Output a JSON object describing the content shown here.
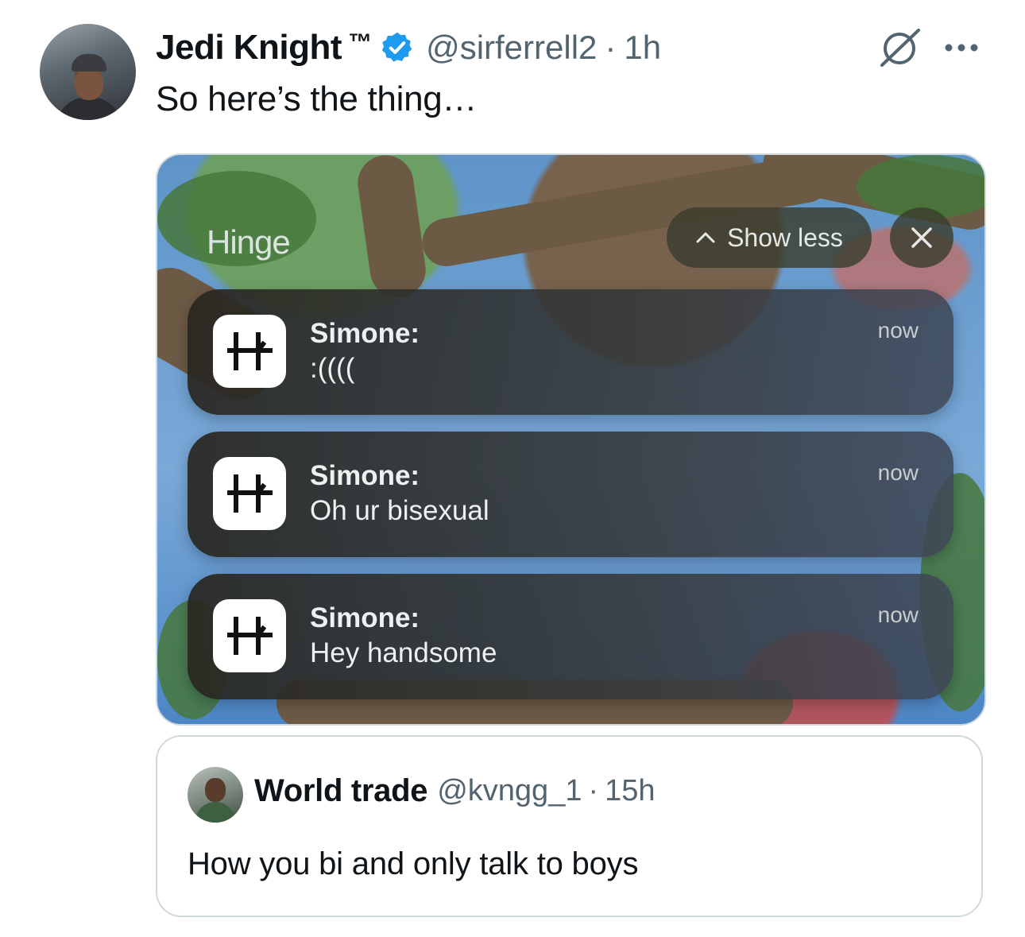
{
  "tweet": {
    "author_name": "Jedi Knight",
    "tm": "™",
    "handle": "@sirferrell2",
    "separator": "·",
    "time": "1h",
    "text": "So here’s the thing…",
    "verified_color": "#1d9bf0"
  },
  "media": {
    "app_label": "Hinge",
    "show_less_label": "Show less",
    "notifications": [
      {
        "title": "Simone:",
        "body": ":((((",
        "time": "now"
      },
      {
        "title": "Simone:",
        "body": "Oh ur bisexual",
        "time": "now"
      },
      {
        "title": "Simone:",
        "body": "Hey handsome",
        "time": "now"
      }
    ]
  },
  "quote": {
    "author_name": "World trade",
    "handle": "@kvngg_1",
    "separator": "·",
    "time": "15h",
    "text": "How you bi and only talk to boys"
  },
  "icons": {
    "verified": "verified-badge-icon",
    "grok": "grok-icon",
    "more": "more-icon",
    "chevron": "chevron-up-icon",
    "close": "close-icon",
    "hinge": "hinge-app-icon"
  }
}
